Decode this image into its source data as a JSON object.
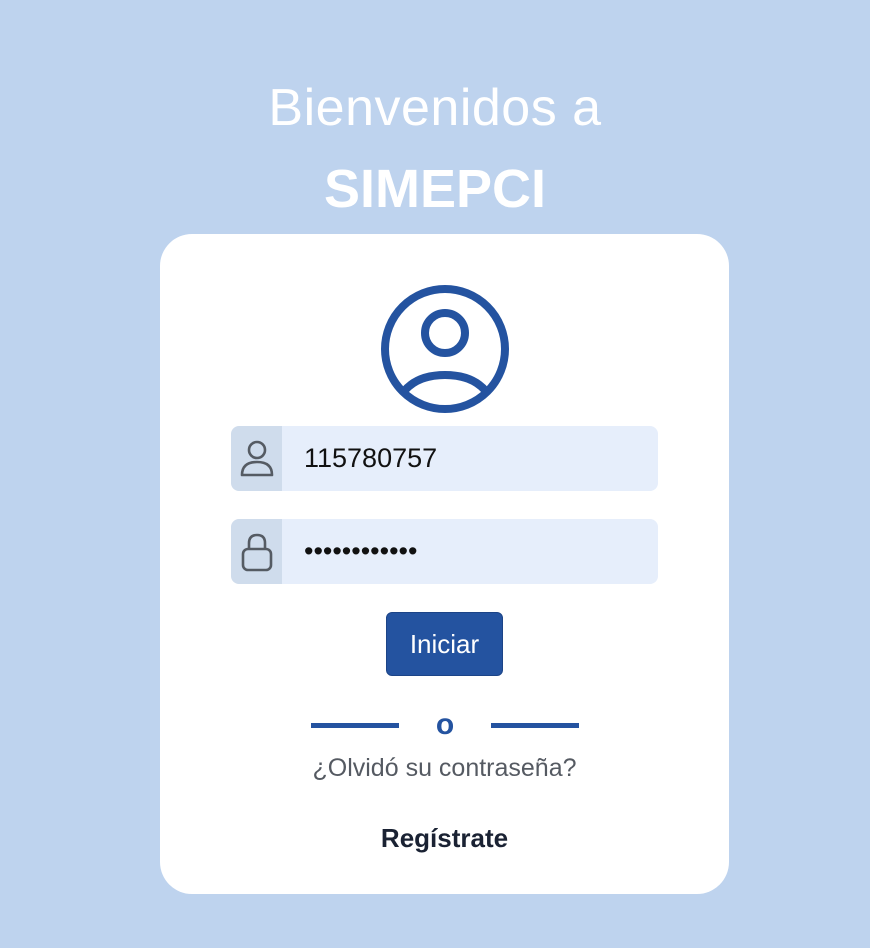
{
  "header": {
    "welcome": "Bienvenidos a",
    "brand": "SIMEPCI"
  },
  "login": {
    "avatar_icon": "user-circle-icon",
    "username": {
      "icon": "user-icon",
      "value": "115780757"
    },
    "password": {
      "icon": "lock-icon",
      "value": "••••••••••••"
    },
    "submit_label": "Iniciar",
    "separator": "o",
    "forgot_label": "¿Olvidó su contraseña?",
    "register_label": "Regístrate"
  },
  "colors": {
    "background": "#bed3ee",
    "accent": "#2453a0",
    "input_bg": "#e6eefb",
    "addon_bg": "#cfdcec"
  }
}
